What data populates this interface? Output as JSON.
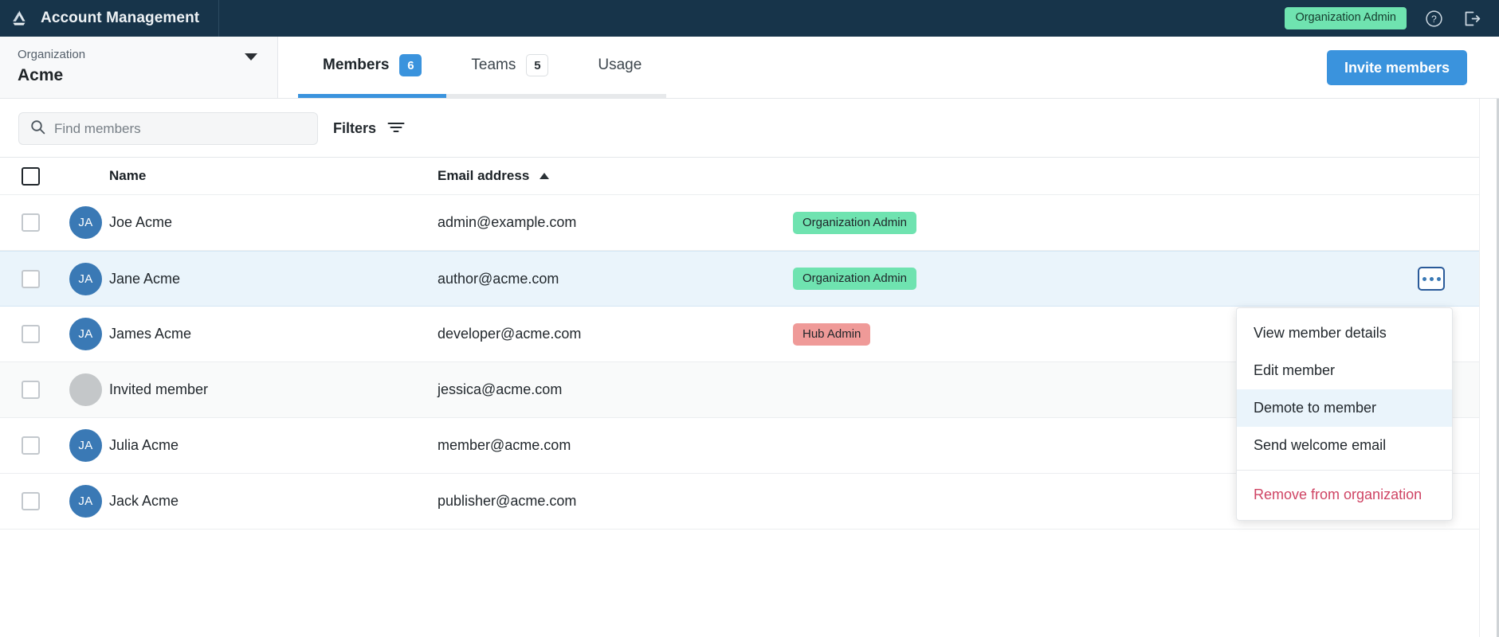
{
  "topbar": {
    "logo_icon": "triangle-recycle-logo-icon",
    "title": "Account Management",
    "role_chip": "Organization Admin",
    "help_icon": "question-circle-icon",
    "logout_icon": "logout-icon"
  },
  "org_selector": {
    "label": "Organization",
    "value": "Acme",
    "caret_icon": "chevron-down-icon"
  },
  "tabs": [
    {
      "label": "Members",
      "badge": "6",
      "badge_style": "filled",
      "active": true
    },
    {
      "label": "Teams",
      "badge": "5",
      "badge_style": "outline",
      "active": false
    },
    {
      "label": "Usage",
      "badge": "",
      "badge_style": "none",
      "active": false
    }
  ],
  "actions": {
    "invite_label": "Invite members"
  },
  "toolbar": {
    "search_placeholder": "Find members",
    "search_value": "",
    "search_icon": "search-icon",
    "filters_label": "Filters",
    "filters_icon": "filter-icon"
  },
  "table": {
    "columns": {
      "name": "Name",
      "email": "Email address",
      "sort_icon": "sort-ascending-icon"
    },
    "rows": [
      {
        "initials": "JA",
        "name": "Joe Acme",
        "email": "admin@example.com",
        "role": "Organization Admin",
        "role_color": "green",
        "state": "normal"
      },
      {
        "initials": "JA",
        "name": "Jane Acme",
        "email": "author@acme.com",
        "role": "Organization Admin",
        "role_color": "green",
        "state": "highlighted"
      },
      {
        "initials": "JA",
        "name": "James Acme",
        "email": "developer@acme.com",
        "role": "Hub Admin",
        "role_color": "red",
        "state": "normal"
      },
      {
        "initials": "",
        "name": "Invited member",
        "email": "jessica@acme.com",
        "role": "",
        "role_color": "none",
        "state": "invited"
      },
      {
        "initials": "JA",
        "name": "Julia Acme",
        "email": "member@acme.com",
        "role": "",
        "role_color": "none",
        "state": "normal"
      },
      {
        "initials": "JA",
        "name": "Jack Acme",
        "email": "publisher@acme.com",
        "role": "",
        "role_color": "none",
        "state": "normal"
      }
    ]
  },
  "row_menu": {
    "trigger_icon": "kebab-menu-icon",
    "items": [
      {
        "label": "View member details",
        "style": "normal"
      },
      {
        "label": "Edit member",
        "style": "normal"
      },
      {
        "label": "Demote to member",
        "style": "active"
      },
      {
        "label": "Send welcome email",
        "style": "normal"
      },
      {
        "label": "Remove from organization",
        "style": "danger"
      }
    ]
  },
  "colors": {
    "topbar_bg": "#17344a",
    "accent_blue": "#3a93dd",
    "badge_green": "#6fe3b0",
    "badge_red": "#ef9a98",
    "danger_text": "#cf4464",
    "row_highlight": "#eaf4fb"
  }
}
